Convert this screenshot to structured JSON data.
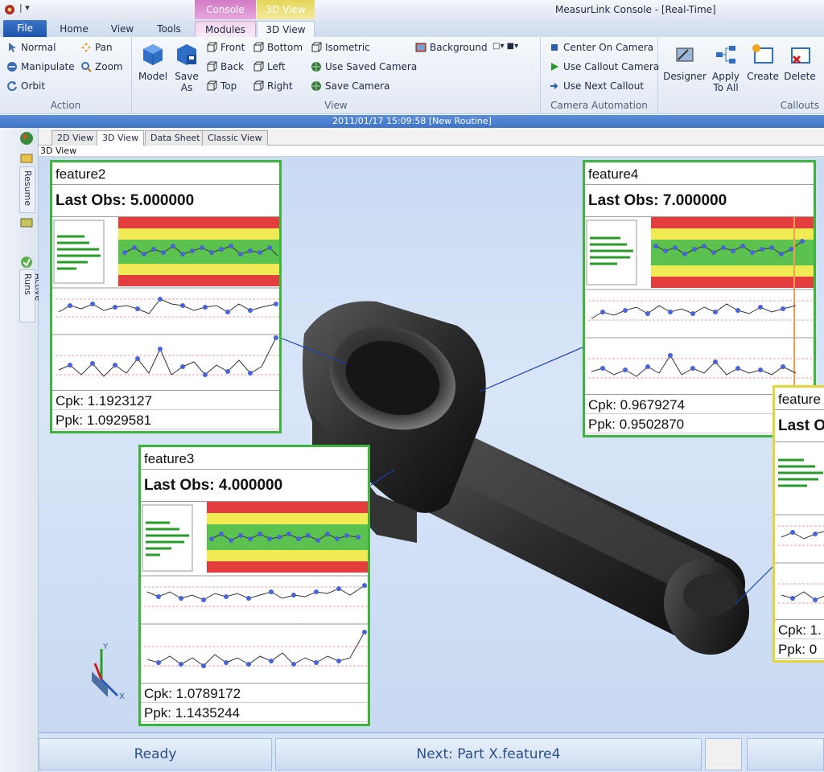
{
  "window": {
    "title": "MeasurLink Console - [Real-Time]"
  },
  "context_tabs": {
    "console": "Console",
    "view3d": "3D View"
  },
  "tabs": [
    "File",
    "Home",
    "View",
    "Tools",
    "Modules",
    "3D View"
  ],
  "ribbon": {
    "action": {
      "label": "Action",
      "normal": "Normal",
      "pan": "Pan",
      "manipulate": "Manipulate",
      "zoom": "Zoom",
      "orbit": "Orbit"
    },
    "view": {
      "label": "View",
      "model": "Model",
      "save_as": "Save As",
      "front": "Front",
      "back": "Back",
      "top": "Top",
      "bottom": "Bottom",
      "left": "Left",
      "right": "Right",
      "isometric": "Isometric",
      "use_saved_camera": "Use Saved Camera",
      "save_camera": "Save Camera",
      "background": "Background"
    },
    "camera": {
      "label": "Camera Automation",
      "center": "Center On Camera",
      "use_callout": "Use Callout Camera",
      "use_next": "Use Next Callout"
    },
    "callouts": {
      "label": "Callouts",
      "designer": "Designer",
      "apply_all": "Apply To All",
      "create": "Create",
      "delete": "Delete"
    }
  },
  "routine_status": "2011/01/17 15:09:58 [New Routine]",
  "side_tabs": [
    "Resume",
    "Active Runs"
  ],
  "doc_tabs": [
    "2D View",
    "3D View",
    "Data Sheet",
    "Classic View"
  ],
  "view_label": "3D View",
  "callouts": [
    {
      "name": "feature2",
      "last_obs": "Last Obs: 5.000000",
      "cpk": "Cpk: 1.1923127",
      "ppk": "Ppk: 1.0929581",
      "color": "#3db53d"
    },
    {
      "name": "feature4",
      "last_obs": "Last Obs: 7.000000",
      "cpk": "Cpk: 0.9679274",
      "ppk": "Ppk: 0.9502870",
      "color": "#3db53d"
    },
    {
      "name": "feature3",
      "last_obs": "Last Obs: 4.000000",
      "cpk": "Cpk: 1.0789172",
      "ppk": "Ppk: 1.1435244",
      "color": "#3db53d"
    },
    {
      "name": "feature",
      "last_obs": "Last O",
      "cpk": "Cpk: 1.",
      "ppk": "Ppk: 0",
      "color": "#e3d53a"
    }
  ],
  "status": {
    "ready": "Ready",
    "next": "Next: Part X.feature4"
  }
}
